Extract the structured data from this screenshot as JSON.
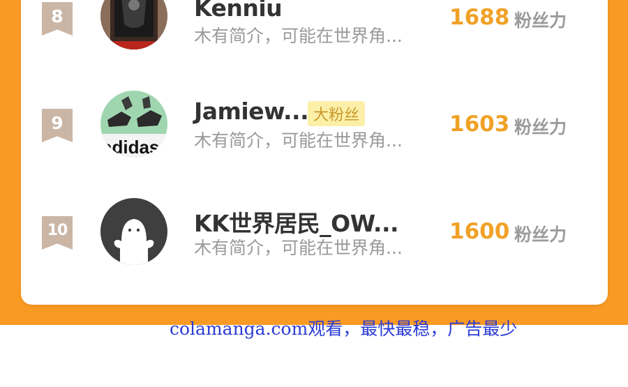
{
  "ranking": {
    "items": [
      {
        "rank": "8",
        "name": "Kenniu",
        "tag": "",
        "bio": "木有简介，可能在世界角...",
        "score": "1688",
        "score_unit": "粉丝力",
        "avatar_icon": "framed-picture-avatar-icon"
      },
      {
        "rank": "9",
        "name": "Jamiew...",
        "tag": "大粉丝",
        "bio": "木有简介，可能在世界角...",
        "score": "1603",
        "score_unit": "粉丝力",
        "avatar_icon": "sneakers-adidas-avatar-icon"
      },
      {
        "rank": "10",
        "name": "KK世界居民_OW...",
        "tag": "",
        "bio": "木有简介，可能在世界角...",
        "score": "1600",
        "score_unit": "粉丝力",
        "avatar_icon": "default-user-avatar-icon"
      }
    ]
  },
  "footer": {
    "link_text": "colamanga.com观看，最快最稳，广告最少"
  },
  "colors": {
    "orange_bg": "#f99a24",
    "score": "#f0a126",
    "badge": "#cbb6a6",
    "link": "#2b3bd6"
  }
}
